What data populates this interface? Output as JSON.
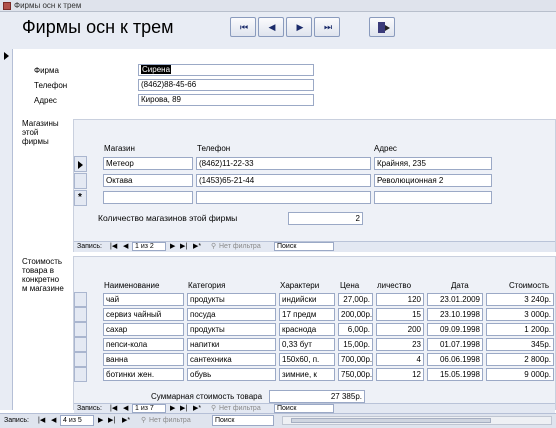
{
  "window": {
    "title": "Фирмы осн к трем"
  },
  "form": {
    "title": "Фирмы осн к трем",
    "nav_buttons": [
      "⏮",
      "◀",
      "▶",
      "⏭"
    ],
    "labels": {
      "firm": "Фирма",
      "phone": "Телефон",
      "address": "Адрес"
    },
    "values": {
      "firm": "Сирена",
      "phone": "(8462)88-45-66",
      "address": "Кирова, 89"
    }
  },
  "stores": {
    "section_label_lines": [
      "Магазины",
      "этой",
      "фирмы"
    ],
    "columns": [
      "Магазин",
      "Телефон",
      "Адрес"
    ],
    "rows": [
      [
        "Метеор",
        "(8462)11-22-33",
        "Крайняя, 235"
      ],
      [
        "Октава",
        "(1453)65-21-44",
        "Революционная 2"
      ]
    ],
    "count_label": "Количество магазинов этой фирмы",
    "count_value": "2",
    "nav": {
      "record_label": "Запись:",
      "position": "1 из 2",
      "filter": "Нет фильтра",
      "search": "Поиск"
    }
  },
  "goods": {
    "section_label_lines": [
      "Стоимость",
      "товара в",
      "конкретно",
      "м магазине"
    ],
    "columns": [
      "Наименование",
      "Категория",
      "Характери",
      "Цена",
      "личество",
      "Дата",
      "Стоимость"
    ],
    "rows": [
      [
        "чай",
        "продукты",
        "индийски",
        "27,00р.",
        "120",
        "23.01.2009",
        "3 240р."
      ],
      [
        "сервиз чайный",
        "посуда",
        "17 предм",
        "200,00р.",
        "15",
        "23.10.1998",
        "3 000р."
      ],
      [
        "сахар",
        "продукты",
        "краснода",
        "6,00р.",
        "200",
        "09.09.1998",
        "1 200р."
      ],
      [
        "пепси-кола",
        "напитки",
        "0,33 бут",
        "15,00р.",
        "23",
        "01.07.1998",
        "345р."
      ],
      [
        "ванна",
        "сантехника",
        "150х60, п.",
        "700,00р.",
        "4",
        "06.06.1998",
        "2 800р."
      ],
      [
        "ботинки жен.",
        "обувь",
        "зимние, к",
        "750,00р.",
        "12",
        "15.05.1998",
        "9 000р."
      ]
    ],
    "total_label": "Суммарная стоимость товара",
    "total_value": "27 385р.",
    "nav": {
      "record_label": "Запись:",
      "position": "1 из 7",
      "filter": "Нет фильтра",
      "search": "Поиск"
    }
  },
  "status": {
    "record_label": "Запись:",
    "position": "4 из 5",
    "filter": "Нет фильтра",
    "search": "Поиск"
  }
}
